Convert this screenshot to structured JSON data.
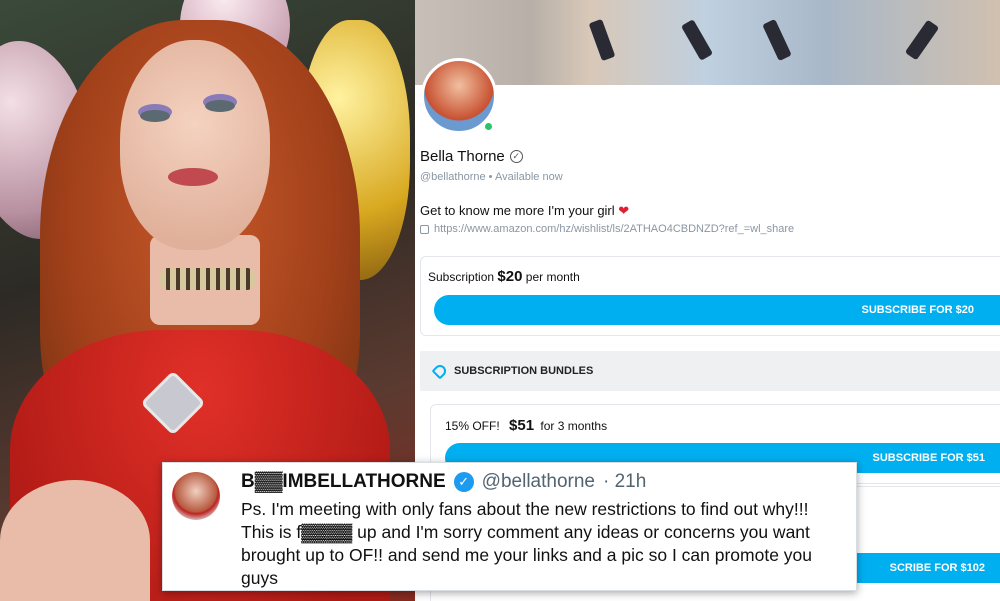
{
  "profile": {
    "name": "Bella Thorne",
    "handle": "@bellathorne",
    "separator": "•",
    "status": "Available now",
    "bio": "Get to know me more I'm your girl",
    "bio_emoji": "❤",
    "link": "https://www.amazon.com/hz/wishlist/ls/2ATHAO4CBDNZD?ref_=wl_share"
  },
  "subscription": {
    "label": "Subscription",
    "price": "$20",
    "period": "per month",
    "button": "SUBSCRIBE FOR $20"
  },
  "bundles": {
    "header": "SUBSCRIPTION BUNDLES",
    "items": [
      {
        "discount": "15% OFF!",
        "price": "$51",
        "period": "for 3 months",
        "button": "SUBSCRIBE FOR $51"
      },
      {
        "button": "SCRIBE FOR $102"
      }
    ]
  },
  "tweet": {
    "name": "B▓▓IMBELLATHORNE",
    "handle": "@bellathorne",
    "time": "· 21h",
    "text": "Ps. I'm meeting with only fans about the new restrictions to find out why!!! This is f▓▓▓▓ up and I'm sorry comment any ideas or concerns you want brought up to OF!! and send me your links and a pic so I can promote you guys"
  },
  "colors": {
    "accent": "#00aff0",
    "verified": "#1d9bf0",
    "online": "#29c46a"
  },
  "icons": [
    "verified-icon",
    "link-icon",
    "tag-icon",
    "twitter-verified-icon"
  ]
}
